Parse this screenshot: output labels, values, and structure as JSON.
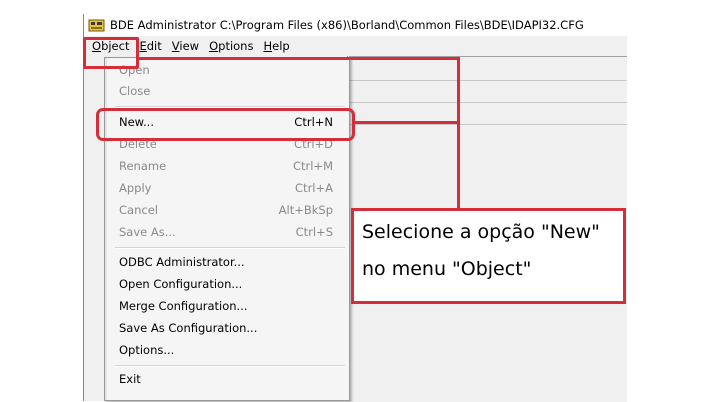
{
  "window": {
    "title": "BDE Administrator  C:\\Program Files (x86)\\Borland\\Common Files\\BDE\\IDAPI32.CFG",
    "icon": "bde-app-icon"
  },
  "menubar": {
    "items": [
      {
        "key": "O",
        "rest": "bject"
      },
      {
        "key": "E",
        "rest": "dit"
      },
      {
        "key": "V",
        "rest": "iew"
      },
      {
        "key": "O",
        "rest": "ptions"
      },
      {
        "key": "H",
        "rest": "elp"
      }
    ]
  },
  "object_menu": {
    "items": [
      {
        "label": "Open",
        "shortcut": "",
        "enabled": false
      },
      {
        "label": "Close",
        "shortcut": "",
        "enabled": false
      },
      {
        "label": "New...",
        "shortcut": "Ctrl+N",
        "enabled": true
      },
      {
        "label": "Delete",
        "shortcut": "Ctrl+D",
        "enabled": false
      },
      {
        "label": "Rename",
        "shortcut": "Ctrl+M",
        "enabled": false
      },
      {
        "label": "Apply",
        "shortcut": "Ctrl+A",
        "enabled": false
      },
      {
        "label": "Cancel",
        "shortcut": "Alt+BkSp",
        "enabled": false
      },
      {
        "label": "Save As...",
        "shortcut": "Ctrl+S",
        "enabled": false
      },
      {
        "label": "ODBC Administrator...",
        "shortcut": "",
        "enabled": true
      },
      {
        "label": "Open Configuration...",
        "shortcut": "",
        "enabled": true
      },
      {
        "label": "Merge Configuration...",
        "shortcut": "",
        "enabled": true
      },
      {
        "label": "Save As Configuration...",
        "shortcut": "",
        "enabled": true
      },
      {
        "label": "Options...",
        "shortcut": "",
        "enabled": true
      },
      {
        "label": "Exit",
        "shortcut": "",
        "enabled": true
      }
    ]
  },
  "annotation": {
    "line1": "Selecione a opção \"New\"",
    "line2": "no menu \"Object\"",
    "color": "#d42e3b"
  }
}
